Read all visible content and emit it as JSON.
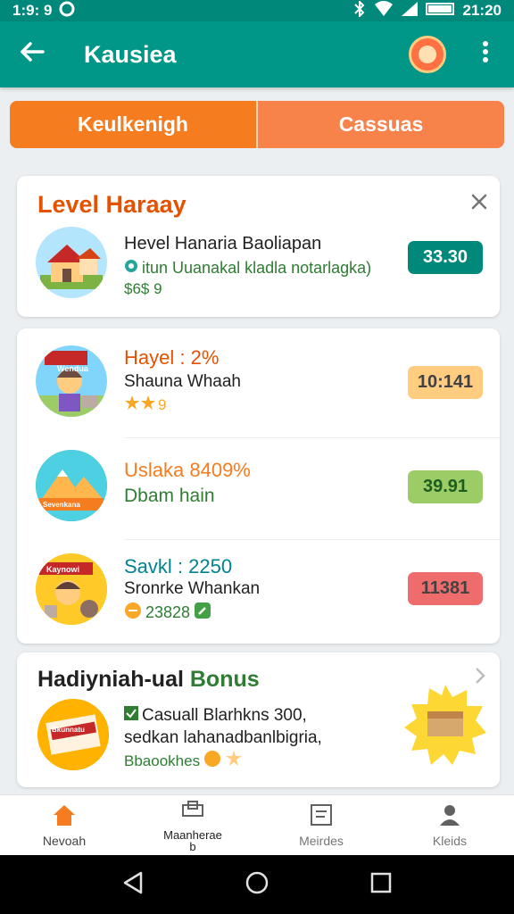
{
  "status_bar": {
    "time": "1:9: 9",
    "right_time": "21:20"
  },
  "app_bar": {
    "title": "Kausiea"
  },
  "tabs": [
    {
      "label": "Keulkenigh",
      "active": true
    },
    {
      "label": "Cassuas",
      "active": false
    }
  ],
  "level_card": {
    "title": "Level Haraay",
    "item": {
      "name": "Hevel Hanaria Baoliapan",
      "desc": "itun Uuanakal kladla notarlagka)",
      "meta": "$6$ 9",
      "value": "33.30",
      "value_color": "#00897b"
    }
  },
  "list_card": {
    "items": [
      {
        "title": "Hayel : 2%",
        "subtitle": "Shauna Whaah",
        "meta": "9",
        "value": "10:141",
        "title_color": "#e65100",
        "pill_bg": "#ffcc80",
        "pill_fg": "#424242",
        "thumb_label": "Wendua"
      },
      {
        "title": "Uslaka 8409%",
        "subtitle": "Dbam hain",
        "meta": "",
        "value": "39.91",
        "title_color": "#f57c1f",
        "pill_bg": "#9ccc65",
        "pill_fg": "#1b5e20",
        "thumb_label": "Sevenkana"
      },
      {
        "title": "Savkl : 2250",
        "subtitle": "Sronrke Whankan",
        "meta": "23828",
        "value": "11381",
        "title_color": "#00838f",
        "pill_bg": "#ef6c6c",
        "pill_fg": "#424242",
        "thumb_label": "Kaynowi"
      }
    ]
  },
  "bonus_card": {
    "title_part1": "Hadiyniah-ual",
    "title_part2": "Bonus",
    "line1": "Casuall Blarhkns 300,",
    "line2": "sedkan lahanadbanlbigria,",
    "line3": "Bbaookhes",
    "thumb_label": "Bkunnatu"
  },
  "bottom_nav": [
    {
      "label": "Nevoah",
      "icon": "home-icon",
      "active": true
    },
    {
      "label": "Maanherae\nb",
      "icon": "tools-icon",
      "active": false
    },
    {
      "label": "Meirdes",
      "icon": "message-icon",
      "active": false
    },
    {
      "label": "Kleids",
      "icon": "person-icon",
      "active": false
    }
  ]
}
